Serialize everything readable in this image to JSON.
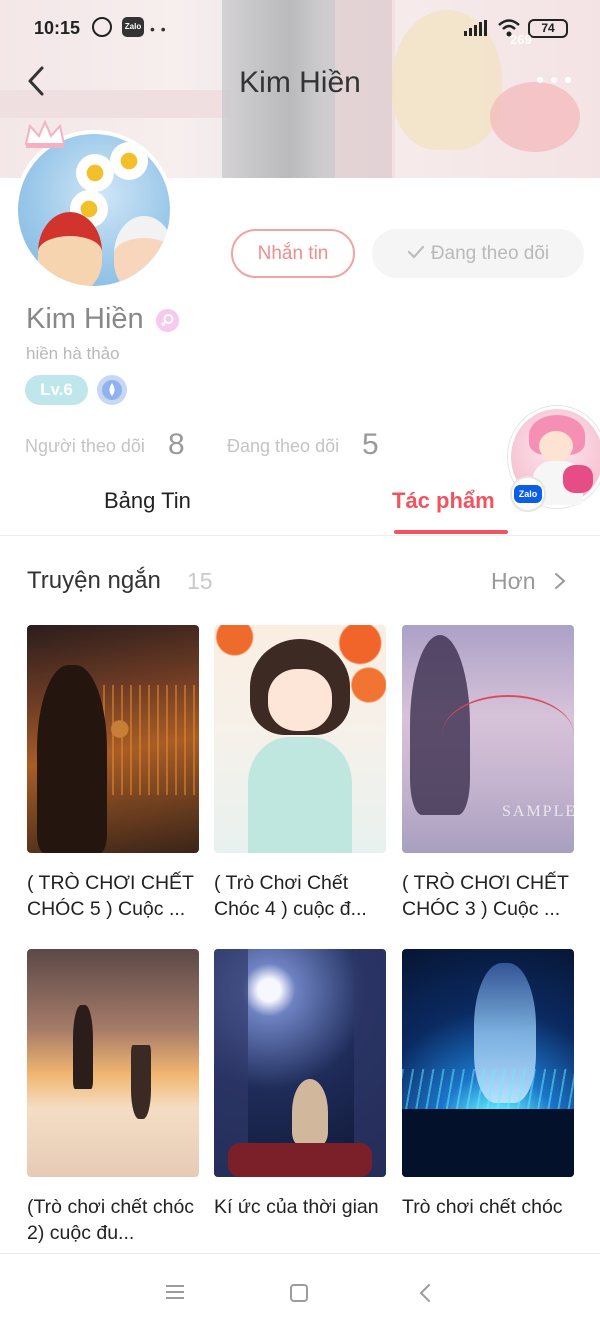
{
  "status_bar": {
    "time": "10:15",
    "zalo_label": "Zalo",
    "battery": "74",
    "badge_value": "269"
  },
  "header": {
    "title": "Kim Hiền"
  },
  "profile": {
    "name": "Kim Hiền",
    "handle": "hiền hà thảo",
    "level": "Lv.6",
    "message_button": "Nhắn tin",
    "following_button": "Đang theo dõi",
    "followers_label": "Người theo dõi",
    "followers_count": "8",
    "following_label": "Đang theo dõi",
    "following_count": "5"
  },
  "tabs": [
    {
      "label": "Bảng Tin",
      "active": false
    },
    {
      "label": "Tác phẩm",
      "active": true
    }
  ],
  "floating_widget": {
    "badge": "Zalo"
  },
  "section": {
    "title": "Truyện ngắn",
    "count": "15",
    "more": "Hơn"
  },
  "stories": [
    {
      "title": "( TRÒ CHƠI CHẾT CHÓC 5 ) Cuộc ..."
    },
    {
      "title": "( Trò Chơi Chết Chóc 4 ) cuộc đ..."
    },
    {
      "title": "( TRÒ CHƠI CHẾT CHÓC 3 ) Cuộc ..."
    },
    {
      "title": "(Trò chơi chết chóc 2) cuộc đu..."
    },
    {
      "title": "Kí ức của thời gian"
    },
    {
      "title": "Trò chơi chết chóc"
    }
  ],
  "cover_watermark": "SAMPLE",
  "colors": {
    "accent": "#f0555f",
    "message_border": "#f0a5a5",
    "level_badge": "#bfe7eb"
  }
}
